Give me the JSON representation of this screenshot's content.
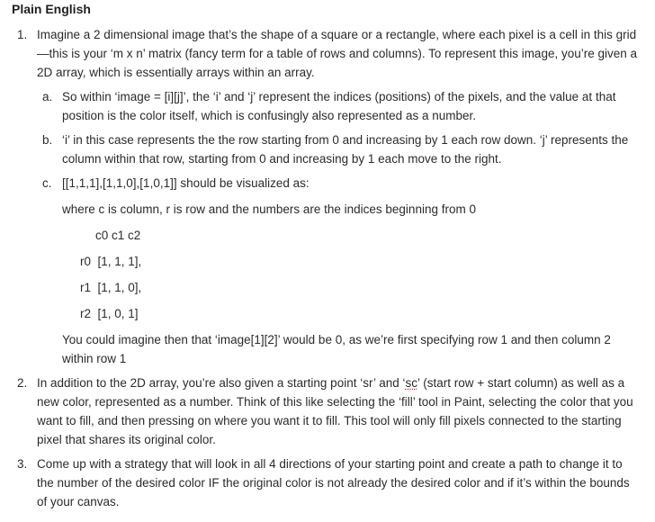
{
  "heading": "Plain English",
  "items": [
    {
      "num": "1.",
      "text": "Imagine a 2 dimensional image that’s the shape of a square or a rectangle, where each pixel is a cell in this grid—this is your ‘m x n’ matrix (fancy term for a table of rows and columns). To represent this image, you’re given a 2D array, which is essentially arrays within an array.",
      "sub": [
        {
          "letter": "a.",
          "text": "So within ‘image = [i][j]’, the ‘i’ and ‘j’ represent the indices (positions) of the pixels, and the value at that position is the color itself, which is confusingly also represented as a number."
        },
        {
          "letter": "b.",
          "text": "‘i’ in this case represents the the row starting from 0 and increasing by 1 each row down. ‘j’ represents the column within that row, starting from 0 and increasing by 1 each move to the right."
        },
        {
          "letter": "c.",
          "text": "[[1,1,1],[1,1,0],[1,0,1]] should be visualized as:",
          "note": "where c is column, r is row and the numbers are the indices beginning from 0",
          "header": "c0 c1 c2",
          "rows": [
            "r0  [1, 1, 1],",
            "r1  [1, 1, 0],",
            "r2  [1, 0, 1]"
          ],
          "conclusion": "You could imagine then that ‘image[1][2]’ would be 0, as we’re first specifying row 1 and then column 2 within row 1"
        }
      ]
    },
    {
      "num": "2.",
      "text_before": "In addition to the 2D array, you’re also given a starting point ‘sr’ and ‘",
      "text_sq": "sc",
      "text_after": "’ (start row + start column) as well as a new color, represented as a number. Think of this like selecting the ‘fill’ tool in Paint, selecting the color that you want to fill, and then pressing on where you want it to fill. This tool will only fill pixels connected to the starting pixel that shares its original color."
    },
    {
      "num": "3.",
      "text": "Come up with a strategy that will look in all 4 directions of your starting point and create a path to change it to the number of the desired color IF the original color is not already the desired color and if it’s within the bounds of your canvas."
    }
  ]
}
